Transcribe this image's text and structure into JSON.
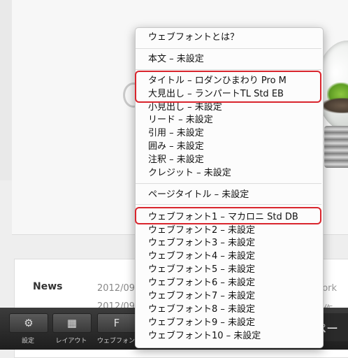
{
  "page": {
    "news_label": "News",
    "news_rows": [
      {
        "date": "2012/09",
        "tail": "e Work"
      },
      {
        "date": "2012/09",
        "tail": "映像作"
      }
    ]
  },
  "toolbar": {
    "buttons": [
      {
        "icon": "⚙",
        "label": "設定"
      },
      {
        "icon": "▦",
        "label": "レイアウト"
      },
      {
        "icon": "F",
        "label": "ウェブフォン"
      }
    ],
    "right_text": "のペー"
  },
  "menu": {
    "header": "ウェブフォントとは？",
    "group1": [
      "本文 – 未設定"
    ],
    "group2": [
      "タイトル – ロダンひまわり Pro M",
      "大見出し – ランパートTL Std EB",
      "小見出し – 未設定",
      "リード – 未設定",
      "引用 – 未設定",
      "囲み – 未設定",
      "注釈 – 未設定",
      "クレジット – 未設定"
    ],
    "group3": [
      "ページタイトル – 未設定"
    ],
    "group4": [
      "ウェブフォント1 – マカロニ Std DB",
      "ウェブフォント2 – 未設定",
      "ウェブフォント3 – 未設定",
      "ウェブフォント4 – 未設定",
      "ウェブフォント5 – 未設定",
      "ウェブフォント6 – 未設定",
      "ウェブフォント7 – 未設定",
      "ウェブフォント8 – 未設定",
      "ウェブフォント9 – 未設定",
      "ウェブフォント10 – 未設定"
    ],
    "highlight_color": "#d9252d"
  }
}
